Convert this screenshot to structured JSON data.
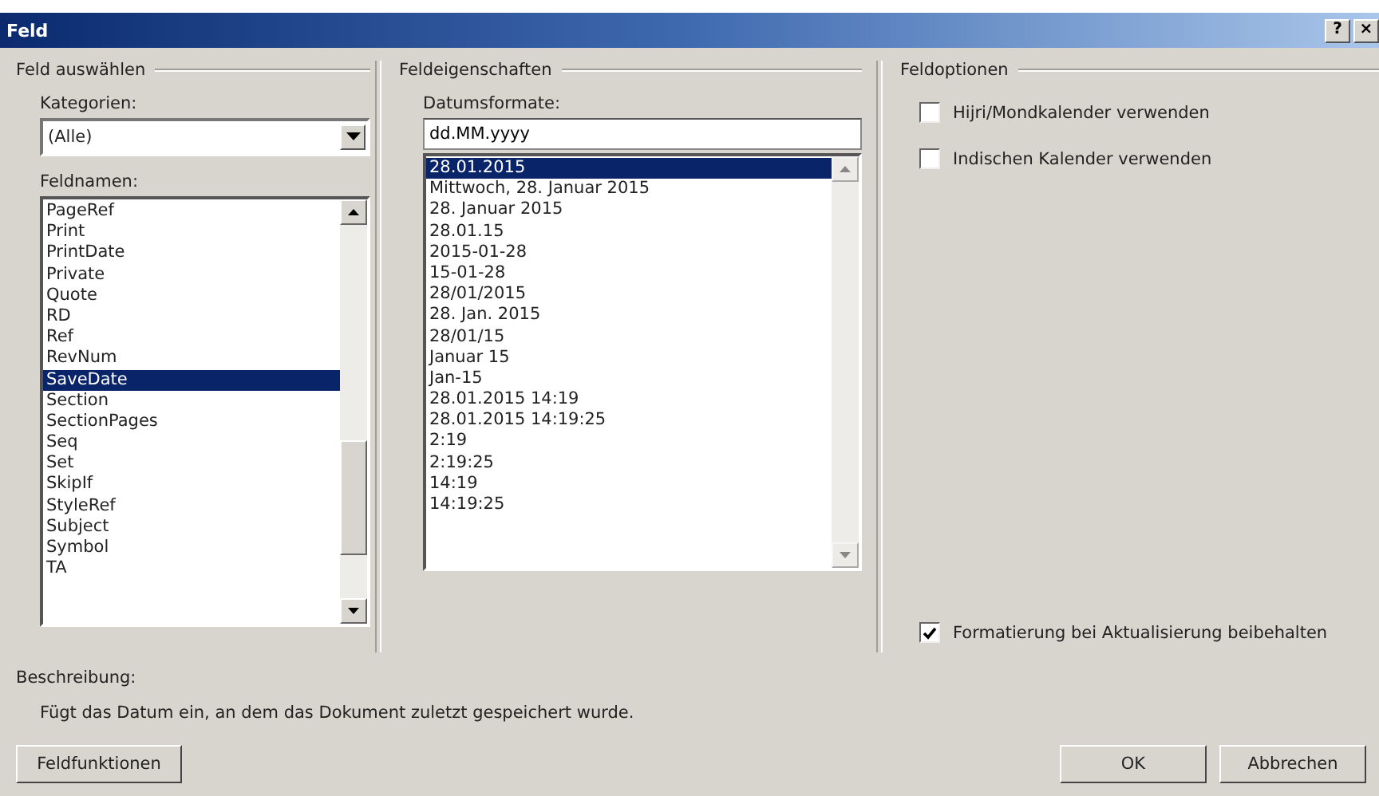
{
  "window": {
    "title": "Feld",
    "help": "?",
    "close": "×"
  },
  "select_field": {
    "title": "Feld auswählen",
    "categories_label": "Kategorien:",
    "category": "(Alle)",
    "names_label": "Feldnamen:",
    "names": [
      {
        "label": "PageRef",
        "selected": false
      },
      {
        "label": "Print",
        "selected": false
      },
      {
        "label": "PrintDate",
        "selected": false
      },
      {
        "label": "Private",
        "selected": false
      },
      {
        "label": "Quote",
        "selected": false
      },
      {
        "label": "RD",
        "selected": false
      },
      {
        "label": "Ref",
        "selected": false
      },
      {
        "label": "RevNum",
        "selected": false
      },
      {
        "label": "SaveDate",
        "selected": true
      },
      {
        "label": "Section",
        "selected": false
      },
      {
        "label": "SectionPages",
        "selected": false
      },
      {
        "label": "Seq",
        "selected": false
      },
      {
        "label": "Set",
        "selected": false
      },
      {
        "label": "SkipIf",
        "selected": false
      },
      {
        "label": "StyleRef",
        "selected": false
      },
      {
        "label": "Subject",
        "selected": false
      },
      {
        "label": "Symbol",
        "selected": false
      },
      {
        "label": "TA",
        "selected": false
      }
    ]
  },
  "field_properties": {
    "title": "Feldeigenschaften",
    "formats_label": "Datumsformate:",
    "format_value": "dd.MM.yyyy",
    "formats": [
      {
        "label": "28.01.2015",
        "selected": true
      },
      {
        "label": "Mittwoch, 28. Januar 2015",
        "selected": false
      },
      {
        "label": "28. Januar 2015",
        "selected": false
      },
      {
        "label": "28.01.15",
        "selected": false
      },
      {
        "label": "2015-01-28",
        "selected": false
      },
      {
        "label": "15-01-28",
        "selected": false
      },
      {
        "label": "28/01/2015",
        "selected": false
      },
      {
        "label": "28. Jan. 2015",
        "selected": false
      },
      {
        "label": "28/01/15",
        "selected": false
      },
      {
        "label": "Januar 15",
        "selected": false
      },
      {
        "label": "Jan-15",
        "selected": false
      },
      {
        "label": "28.01.2015 14:19",
        "selected": false
      },
      {
        "label": "28.01.2015 14:19:25",
        "selected": false
      },
      {
        "label": "2:19",
        "selected": false
      },
      {
        "label": "2:19:25",
        "selected": false
      },
      {
        "label": "14:19",
        "selected": false
      },
      {
        "label": "14:19:25",
        "selected": false
      }
    ]
  },
  "field_options": {
    "title": "Feldoptionen",
    "options": [
      {
        "label": "Hijri/Mondkalender verwenden",
        "checked": false
      },
      {
        "label": "Indischen Kalender verwenden",
        "checked": false
      }
    ],
    "keep_formatting": {
      "label": "Formatierung bei Aktualisierung beibehalten",
      "checked": true
    }
  },
  "description": {
    "label": "Beschreibung:",
    "text": "Fügt das Datum ein, an dem das Dokument zuletzt gespeichert wurde."
  },
  "buttons": {
    "field_codes": "Feldfunktionen",
    "ok": "OK",
    "cancel": "Abbrechen"
  }
}
